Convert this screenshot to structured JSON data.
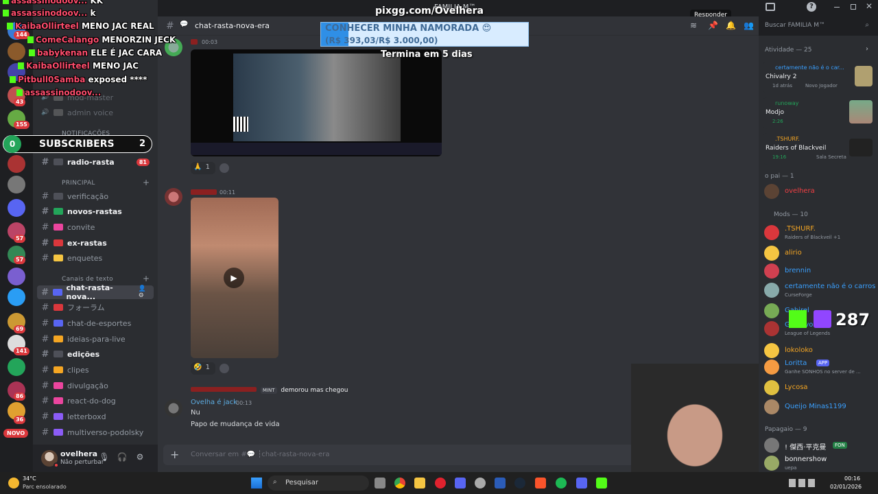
{
  "stream_overlay": {
    "top_text": "pixgg.com/Ovelhera",
    "goal_title": "CONHECER MINHA NAMORADA 😍",
    "goal_amount": "(R$ 393,03/R$ 3.000,00)",
    "goal_progress": 0.131,
    "goal_deadline": "Termina em 5 dias",
    "subscribers_left": "0",
    "subscribers_label": "SUBSCRIBERS",
    "subscribers_right": "2",
    "viewer_count": "287",
    "chat_lines": [
      {
        "user": "assassinodoov...",
        "msg": "KK"
      },
      {
        "user": "assassinodoov...",
        "msg": "k"
      },
      {
        "user": "KaibaOllirteel",
        "msg": "MENO JAC REAL"
      },
      {
        "user": "ComeCalango",
        "msg": "MENORZIN JECK"
      },
      {
        "user": "babykenan",
        "msg": "ELE É JAC CARA"
      },
      {
        "user": "KaibaOllirteel",
        "msg": "MENO JAC"
      },
      {
        "user": "Pitbull0Samba",
        "msg": "exposed ****"
      },
      {
        "user": "assassinodoov...",
        "msg": ""
      }
    ]
  },
  "titlebar": {
    "server_label": "FAMILIA M™",
    "tooltip": "Responder"
  },
  "server_rail": {
    "badges": [
      "144",
      "43",
      "155",
      "57",
      "57",
      "69",
      "141",
      "86",
      "36"
    ],
    "novo": "NOVO"
  },
  "channels": {
    "items": [
      {
        "name": "mod-master",
        "emoji": "⚙",
        "state": "muted"
      },
      {
        "name": "admin voice",
        "emoji": "🔊",
        "state": "muted"
      },
      {
        "name": "radio-rasta",
        "emoji": "📻",
        "state": "bold",
        "count": "81"
      },
      {
        "name": "verificação",
        "emoji": "☑",
        "state": "normal"
      },
      {
        "name": "novos-rastas",
        "emoji": "✅",
        "state": "bold"
      },
      {
        "name": "convite",
        "emoji": "💌",
        "state": "normal"
      },
      {
        "name": "ex-rastas",
        "emoji": "❌",
        "state": "bold"
      },
      {
        "name": "enquetes",
        "emoji": "⭐",
        "state": "normal"
      },
      {
        "name": "chat-rasta-nova...",
        "emoji": "💬",
        "state": "active"
      },
      {
        "name": "フォーラム",
        "emoji": "🔴",
        "state": "normal"
      },
      {
        "name": "chat-de-esportes",
        "emoji": "⚽",
        "state": "normal"
      },
      {
        "name": "ideias-para-live",
        "emoji": "📝",
        "state": "normal"
      },
      {
        "name": "edições",
        "emoji": "🎞",
        "state": "bold"
      },
      {
        "name": "clipes",
        "emoji": "🎬",
        "state": "normal"
      },
      {
        "name": "divulgação",
        "emoji": "📢",
        "state": "normal"
      },
      {
        "name": "react-do-dog",
        "emoji": "🎥",
        "state": "normal"
      },
      {
        "name": "letterboxd",
        "emoji": "📒",
        "state": "normal"
      },
      {
        "name": "multiverso-podolsky",
        "emoji": "👾",
        "state": "normal"
      }
    ],
    "categories": {
      "notificacoes": "NOTIFICAÇÕES",
      "principal": "PRINCIPAL",
      "canais": "Canais de texto"
    }
  },
  "user_panel": {
    "name": "ovelhera",
    "status": "Não perturbar"
  },
  "channel_header": {
    "name": "chat-rasta-nova-era"
  },
  "messages": [
    {
      "time": "00:03",
      "reactions": [
        {
          "emoji": "🙏",
          "count": "1"
        }
      ]
    },
    {
      "time": "00:11",
      "reactions": [
        {
          "emoji": "🤣",
          "count": "1"
        }
      ]
    }
  ],
  "reply": {
    "badge": "MINT",
    "text": "demorou mas chegou"
  },
  "last_message": {
    "author": "Ovelha é jack",
    "time": "00:13",
    "lines": [
      "Nu",
      "Papo de mudança de vida"
    ]
  },
  "composer": {
    "placeholder": "Conversar em #💬 ┆chat-rasta-nova-era"
  },
  "search": {
    "placeholder": "Buscar FAMILIA M™"
  },
  "members": {
    "activity_header": "Atividade — 25",
    "activities": [
      {
        "user": "certamente não é o car...",
        "title": "Chivalry 2",
        "meta": "1d atrás",
        "meta2": "Novo Jogador"
      },
      {
        "user": "runoway",
        "title": "Modjo",
        "meta": "2:26",
        "meta2": ""
      },
      {
        "user": ".TSHURF.",
        "title": "Raiders of Blackveil",
        "meta": "19:16",
        "meta2": "Sala Secreta"
      }
    ],
    "group_pai": "o pai — 1",
    "pai": [
      {
        "name": "ovelhera",
        "color": "#f23f43"
      }
    ],
    "group_mods": "Mods — 10",
    "mods": [
      {
        "name": ".TSHURF.",
        "sub": "Raiders of Blackveil +1",
        "color": "#f5a623"
      },
      {
        "name": "alirio",
        "sub": "",
        "color": "#f5a623"
      },
      {
        "name": "brennin",
        "sub": "",
        "color": "#3aa0ff"
      },
      {
        "name": "certamente não é o carros",
        "sub": "CurseForge",
        "color": "#3aa0ff"
      },
      {
        "name": "Gabirel",
        "sub": "",
        "color": "#3aa0ff"
      },
      {
        "name": "Gustavo",
        "sub": "League of Legends",
        "color": "#3aa0ff"
      },
      {
        "name": "lokoloko",
        "sub": "",
        "color": "#f5a623"
      },
      {
        "name": "Loritta",
        "sub": "Ganhe SONHOS no server de ...",
        "color": "#3aa0ff",
        "tag": "APP"
      },
      {
        "name": "Lycosa",
        "sub": "",
        "color": "#f5a623"
      },
      {
        "name": "Queijo Minas1199",
        "sub": "",
        "color": "#3aa0ff"
      }
    ],
    "group_papagaio": "Papagaio — 9",
    "papagaio": [
      {
        "name": "! 傑西·平克曼",
        "tag": "FON",
        "color": "#f2f3f5"
      },
      {
        "name": "bonnershow",
        "sub": "uepa",
        "color": "#f2f3f5"
      }
    ]
  },
  "taskbar": {
    "weather_temp": "34°C",
    "weather_desc": "Parc ensolarado",
    "search_label": "Pesquisar",
    "time": "00:16",
    "date": "02/01/2026"
  },
  "colors": {
    "accent": "#5865f2",
    "danger": "#da373c",
    "kick_green": "#53fc18",
    "twitch_purple": "#9146ff"
  }
}
